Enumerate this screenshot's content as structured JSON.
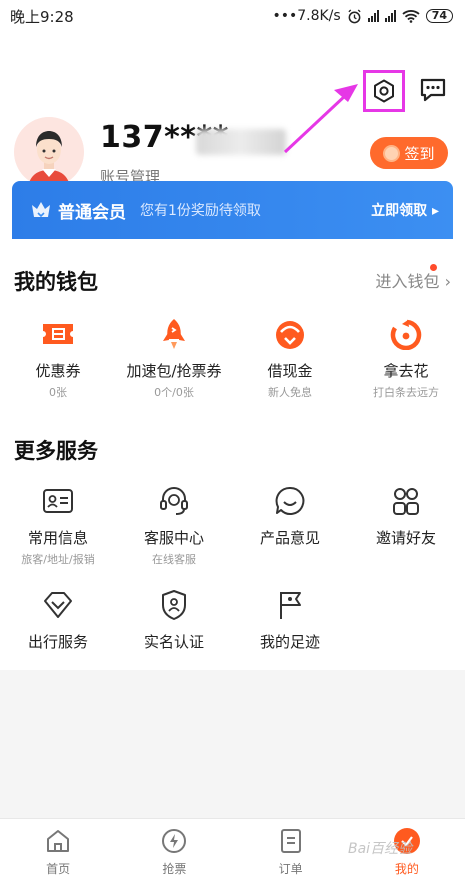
{
  "status_bar": {
    "time": "晚上9:28",
    "network_speed": "•••7.8K/s",
    "battery": "74"
  },
  "profile": {
    "phone_masked": "137****",
    "account_link": "账号管理",
    "checkin_label": "签到"
  },
  "member": {
    "title": "普通会员",
    "tip": "您有1份奖励待领取",
    "action": "立即领取 ▸"
  },
  "wallet": {
    "title": "我的钱包",
    "enter_label": "进入钱包 ›",
    "items": [
      {
        "label": "优惠券",
        "sub": "0张"
      },
      {
        "label": "加速包/抢票券",
        "sub": "0个/0张"
      },
      {
        "label": "借现金",
        "sub": "新人免息"
      },
      {
        "label": "拿去花",
        "sub": "打白条去远方"
      }
    ]
  },
  "services": {
    "title": "更多服务",
    "items": [
      {
        "label": "常用信息",
        "sub": "旅客/地址/报销"
      },
      {
        "label": "客服中心",
        "sub": "在线客服"
      },
      {
        "label": "产品意见",
        "sub": ""
      },
      {
        "label": "邀请好友",
        "sub": ""
      },
      {
        "label": "出行服务",
        "sub": ""
      },
      {
        "label": "实名认证",
        "sub": ""
      },
      {
        "label": "我的足迹",
        "sub": ""
      }
    ]
  },
  "tabbar": {
    "items": [
      {
        "label": "首页",
        "icon": "home-icon"
      },
      {
        "label": "抢票",
        "icon": "lightning-icon"
      },
      {
        "label": "订单",
        "icon": "order-icon"
      },
      {
        "label": "我的",
        "icon": "profile-icon"
      }
    ],
    "active_index": 3
  },
  "watermark": "Bai百经验",
  "colors": {
    "accent": "#ff5a1f",
    "member_blue": "#2d7de8",
    "highlight": "#e637e6"
  }
}
